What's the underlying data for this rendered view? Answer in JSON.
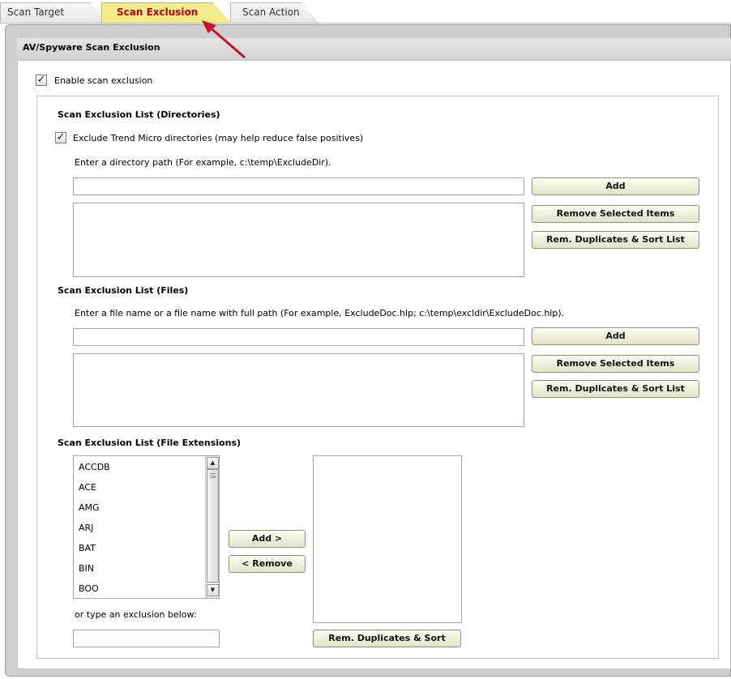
{
  "tabs": [
    {
      "label": "Scan Target",
      "active": false
    },
    {
      "label": "Scan Exclusion",
      "active": true
    },
    {
      "label": "Scan Action",
      "active": false
    }
  ],
  "section_title": "AV/Spyware Scan Exclusion",
  "enable_exclusion": {
    "label": "Enable scan exclusion",
    "checked": true
  },
  "directories": {
    "heading": "Scan Exclusion List (Directories)",
    "exclude_trend": {
      "label": "Exclude Trend Micro directories (may help reduce false positives)",
      "checked": true
    },
    "hint": "Enter a directory path (For example, c:\\temp\\ExcludeDir).",
    "input_value": "",
    "add_label": "Add",
    "remove_label": "Remove Selected Items",
    "sort_label": "Rem. Duplicates & Sort List"
  },
  "files": {
    "heading": "Scan Exclusion List (Files)",
    "hint": "Enter a file name or a file name with full path (For example, ExcludeDoc.hlp; c:\\temp\\excldir\\ExcludeDoc.hlp).",
    "input_value": "",
    "add_label": "Add",
    "remove_label": "Remove Selected Items",
    "sort_label": "Rem. Duplicates & Sort List"
  },
  "extensions": {
    "heading": "Scan Exclusion List (File Extensions)",
    "items": [
      "ACCDB",
      "ACE",
      "AMG",
      "ARJ",
      "BAT",
      "BIN",
      "BOO"
    ],
    "add_label": "Add >",
    "remove_label": "< Remove",
    "type_hint": "or type an exclusion below:",
    "input_value": "",
    "sort_label": "Rem. Duplicates & Sort"
  },
  "colors": {
    "active_tab_bg": "#f4ea8e",
    "active_tab_text": "#c00000",
    "arrow": "#c8102e"
  }
}
